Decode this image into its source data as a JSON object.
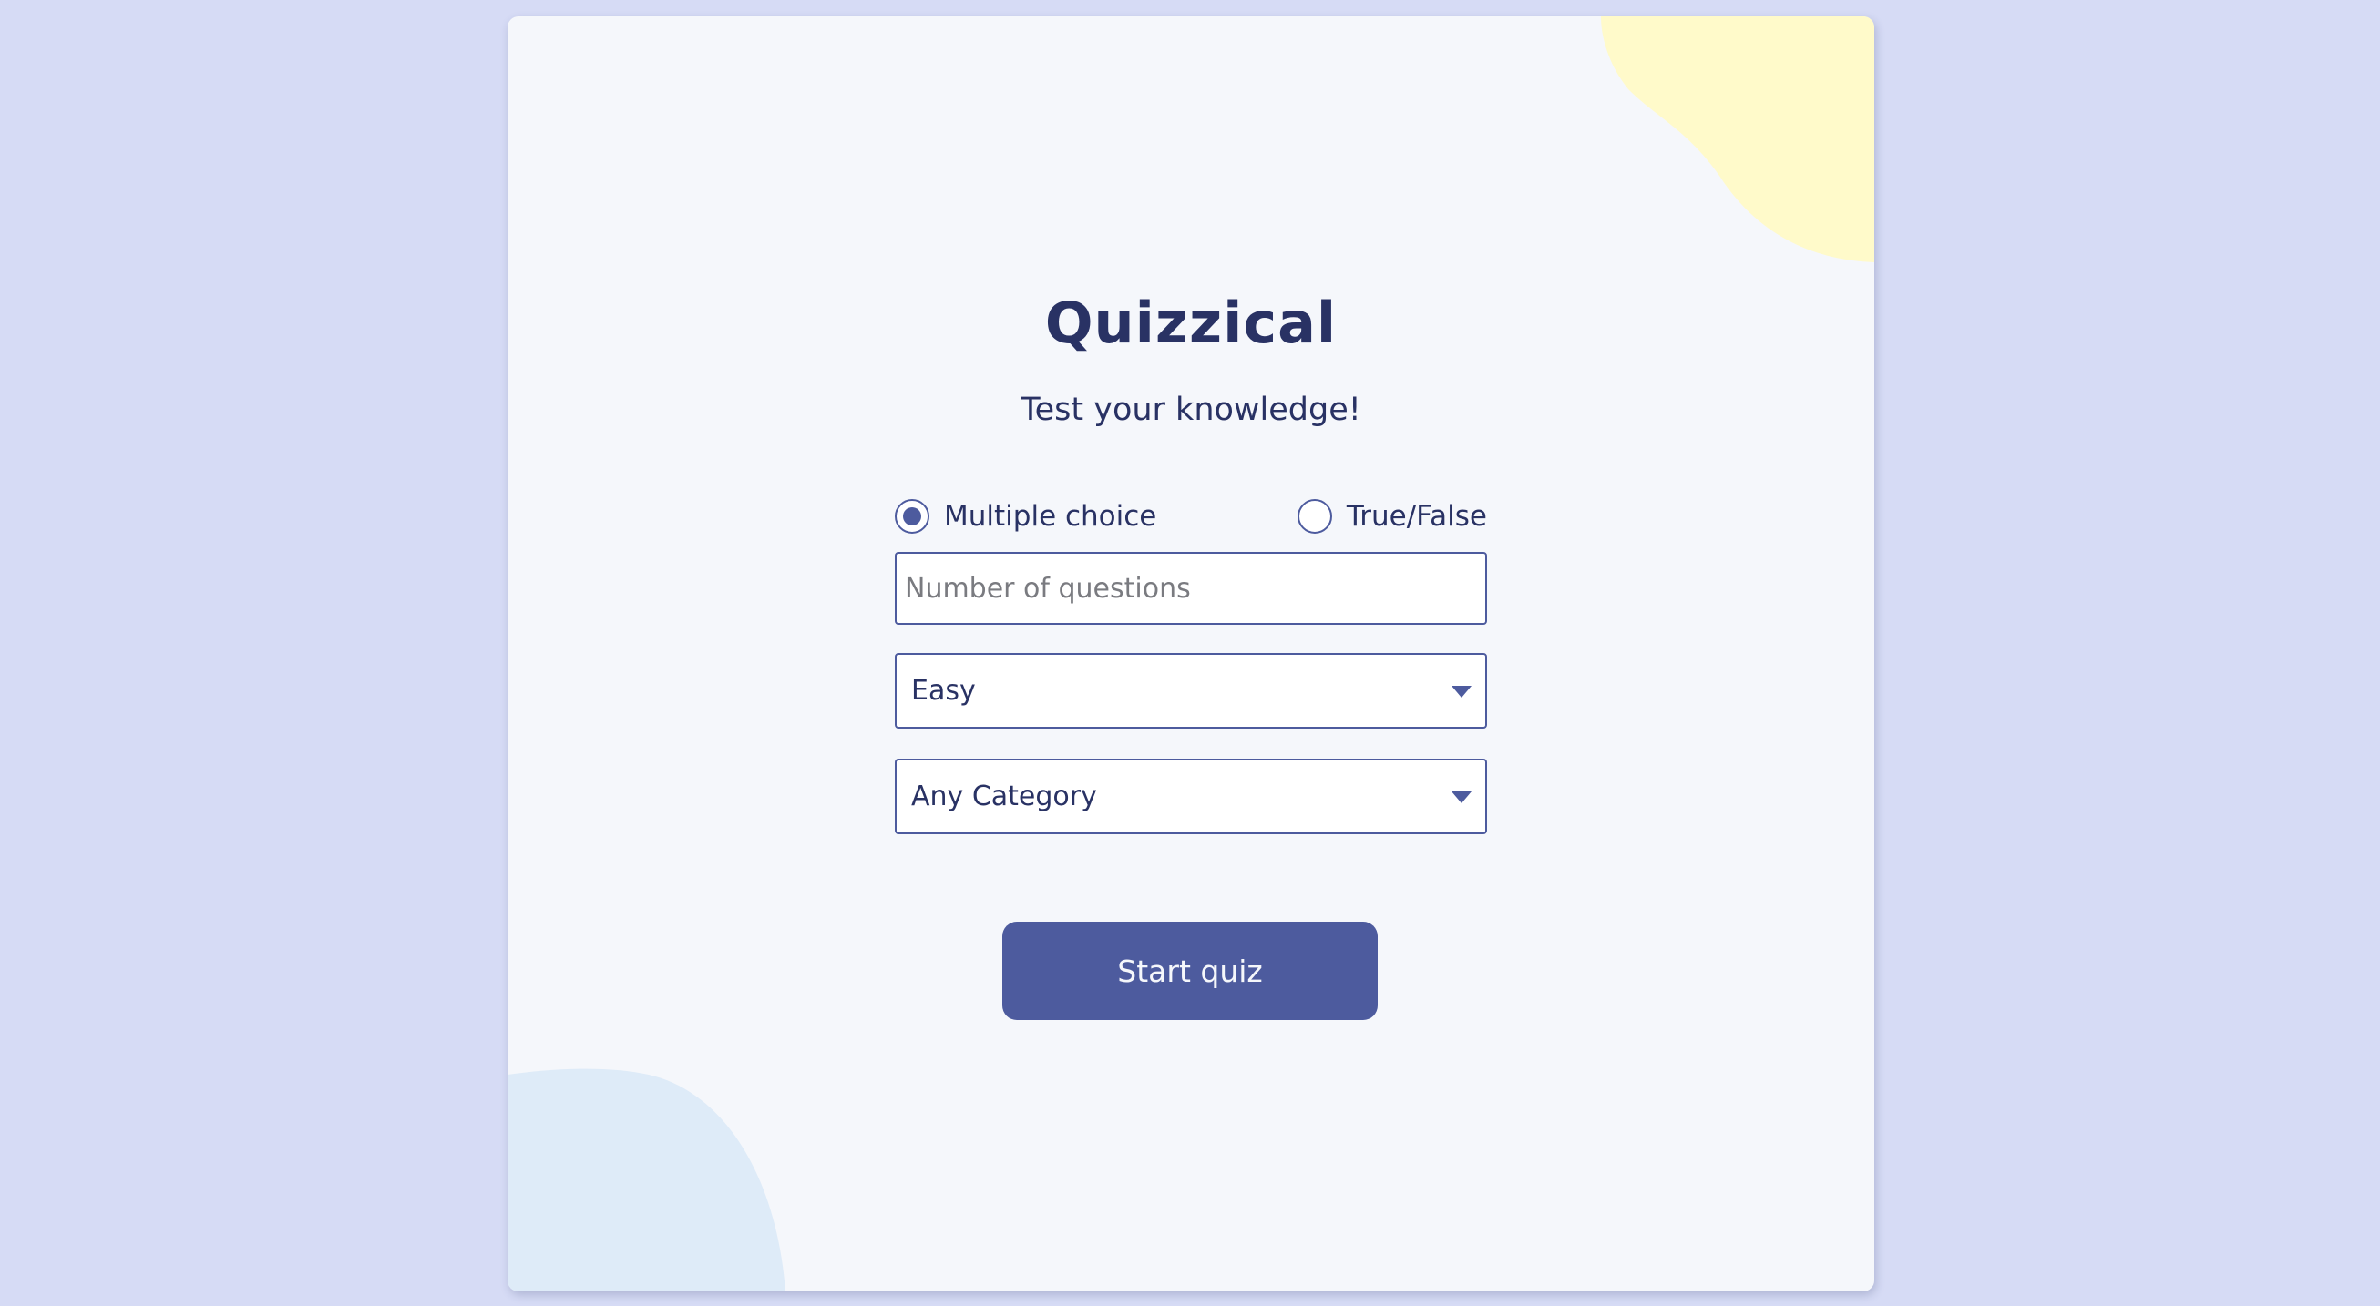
{
  "app": {
    "title": "Quizzical",
    "subtitle": "Test your knowledge!"
  },
  "quiz_type": {
    "options": [
      {
        "label": "Multiple choice",
        "checked": true
      },
      {
        "label": "True/False",
        "checked": false
      }
    ]
  },
  "number_input": {
    "value": "",
    "placeholder": "Number of questions"
  },
  "difficulty_select": {
    "selected": "Easy"
  },
  "category_select": {
    "selected": "Any Category"
  },
  "start_button": {
    "label": "Start quiz"
  },
  "colors": {
    "page_background": "#D6DBF5",
    "card_background": "#F5F7FB",
    "accent": "#4D5B9E",
    "text": "#293264",
    "blob_yellow": "#FFFACA",
    "blob_blue": "#DEEBF8"
  },
  "icons": {
    "dropdown": "caret-down-icon"
  }
}
